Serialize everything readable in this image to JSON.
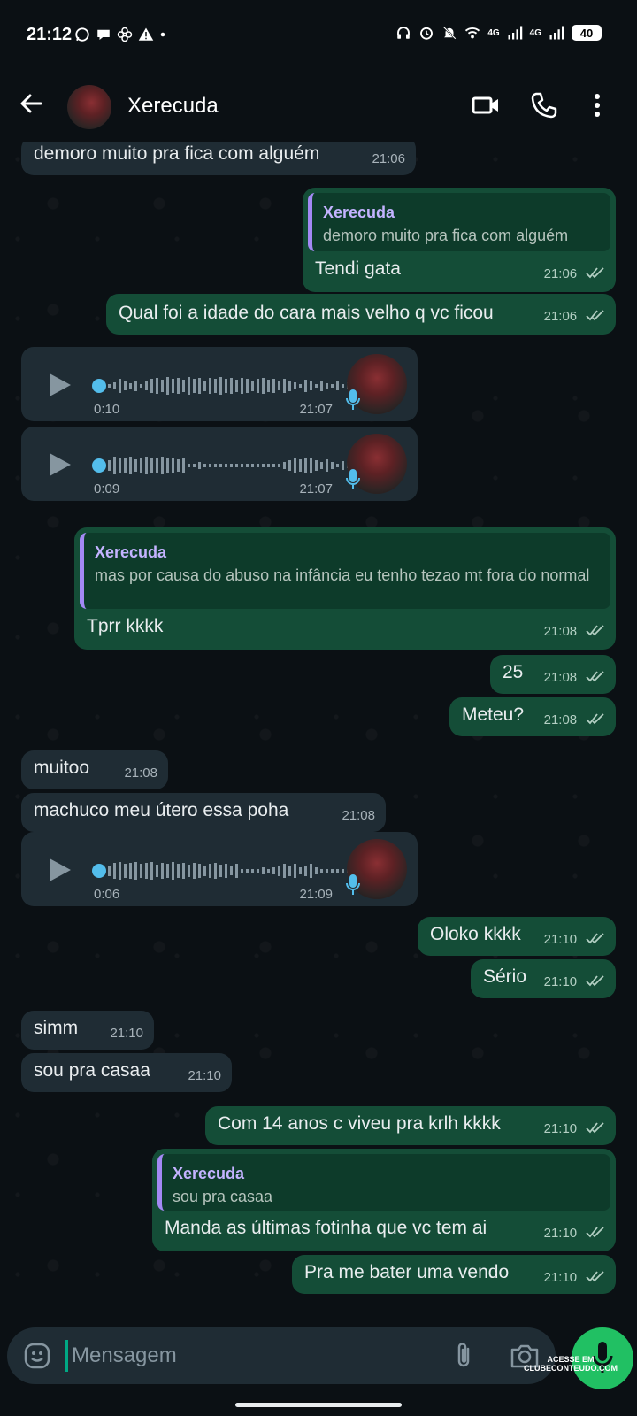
{
  "status_bar": {
    "time": "21:12",
    "battery": "40",
    "network_1": "4G",
    "network_2": "4G",
    "left_icons": [
      "whatsapp-icon",
      "chat-bubble-icon",
      "flower-icon",
      "warning-icon",
      "dot-icon"
    ],
    "right_icons": [
      "headphones-icon",
      "alarm-icon",
      "mute-icon",
      "wifi-icon",
      "signal-icon",
      "signal-icon",
      "battery-icon"
    ]
  },
  "header": {
    "contact_name": "Xerecuda",
    "icons": [
      "back-arrow-icon",
      "video-call-icon",
      "phone-icon",
      "more-vert-icon"
    ]
  },
  "messages": [
    {
      "dir": "in",
      "text": "demoro muito pra fica com alguém",
      "time": "21:06"
    },
    {
      "dir": "out",
      "quote_name": "Xerecuda",
      "quote_text": "demoro muito pra fica com alguém",
      "text": "Tendi gata",
      "time": "21:06"
    },
    {
      "dir": "out",
      "text": "Qual foi a idade do cara mais velho q vc ficou",
      "time": "21:06"
    },
    {
      "dir": "in",
      "voice": true,
      "duration": "0:10",
      "time": "21:07"
    },
    {
      "dir": "in",
      "voice": true,
      "duration": "0:09",
      "time": "21:07"
    },
    {
      "dir": "out",
      "quote_name": "Xerecuda",
      "quote_text": "mas por causa do abuso na infância eu tenho tezao mt fora do normal",
      "text": "Tprr kkkk",
      "time": "21:08"
    },
    {
      "dir": "out",
      "text": "25",
      "time": "21:08"
    },
    {
      "dir": "out",
      "text": "Meteu?",
      "time": "21:08"
    },
    {
      "dir": "in",
      "text": "muitoo",
      "time": "21:08"
    },
    {
      "dir": "in",
      "text": "machuco meu útero essa poha",
      "time": "21:08"
    },
    {
      "dir": "in",
      "voice": true,
      "duration": "0:06",
      "time": "21:09"
    },
    {
      "dir": "out",
      "text": "Oloko kkkk",
      "time": "21:10"
    },
    {
      "dir": "out",
      "text": "Sério",
      "time": "21:10"
    },
    {
      "dir": "in",
      "text": "simm",
      "time": "21:10"
    },
    {
      "dir": "in",
      "text": "sou pra casaa",
      "time": "21:10"
    },
    {
      "dir": "out",
      "text": "Com 14 anos c viveu pra krlh kkkk",
      "time": "21:10"
    },
    {
      "dir": "out",
      "quote_name": "Xerecuda",
      "quote_text": "sou pra casaa",
      "text": "Manda as últimas fotinha que vc tem ai",
      "time": "21:10"
    },
    {
      "dir": "out",
      "text": "Pra me bater uma vendo",
      "time": "21:10"
    }
  ],
  "composer": {
    "placeholder": "Mensagem",
    "watermark_line1": "ACESSE EM",
    "watermark_line2": "CLUBECONTEUDO.COM"
  },
  "colors": {
    "background": "#0b1014",
    "incoming_bubble": "#1f2c34",
    "outgoing_bubble": "#144d37",
    "quote_bar": "#a389f4",
    "accent_green": "#21c063",
    "voice_dot": "#53bdeb"
  }
}
